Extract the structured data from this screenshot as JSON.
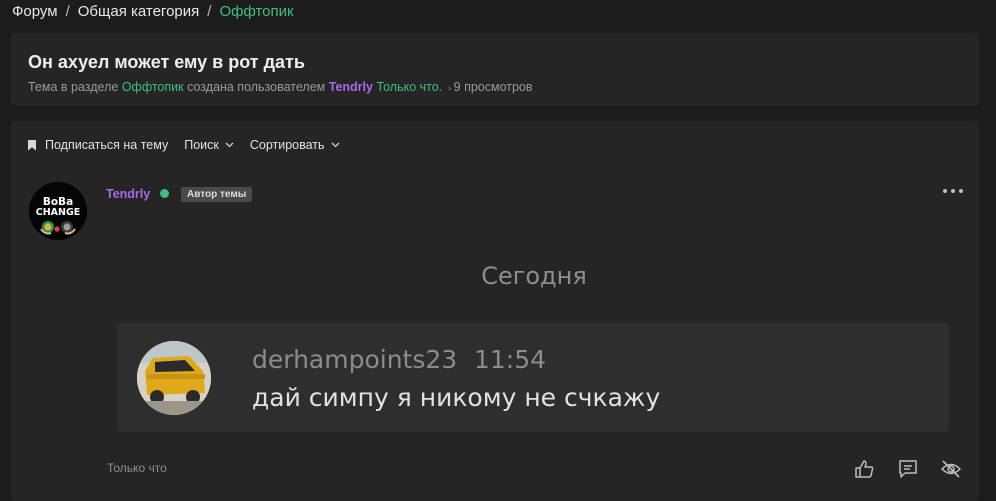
{
  "breadcrumb": {
    "items": [
      "Форум",
      "Общая категория"
    ],
    "separator": "/",
    "current": "Оффтопик"
  },
  "thread": {
    "title": "Он ахуел может ему в рот дать",
    "meta_prefix": "Тема в разделе",
    "section": "Оффтопик",
    "meta_mid": "создана пользователем",
    "author": "Tendrly",
    "created": "Только что.",
    "views": "9 просмотров"
  },
  "toolbar": {
    "subscribe_label": "Подписаться на тему",
    "search_label": "Поиск",
    "sort_label": "Сортировать"
  },
  "post": {
    "author": "Tendrly",
    "badge": "Автор темы",
    "avatar_text": [
      "BoBa",
      "CHANGE"
    ],
    "day_label": "Сегодня",
    "quote": {
      "user": "derhampoints23",
      "time": "11:54",
      "text": "дай симпу я никому не счкажу"
    },
    "time": "Только что"
  },
  "icons": {
    "bookmark": "bookmark-icon",
    "chevron": "chevron-down-icon",
    "more": "more-horizontal-icon",
    "like": "thumbs-up-icon",
    "reply": "comment-icon",
    "hide": "eye-off-icon"
  },
  "colors": {
    "accent_green": "#3fbf7f",
    "user_purple": "#a86ae6",
    "background": "#1c1c1c",
    "panel": "#252525"
  }
}
